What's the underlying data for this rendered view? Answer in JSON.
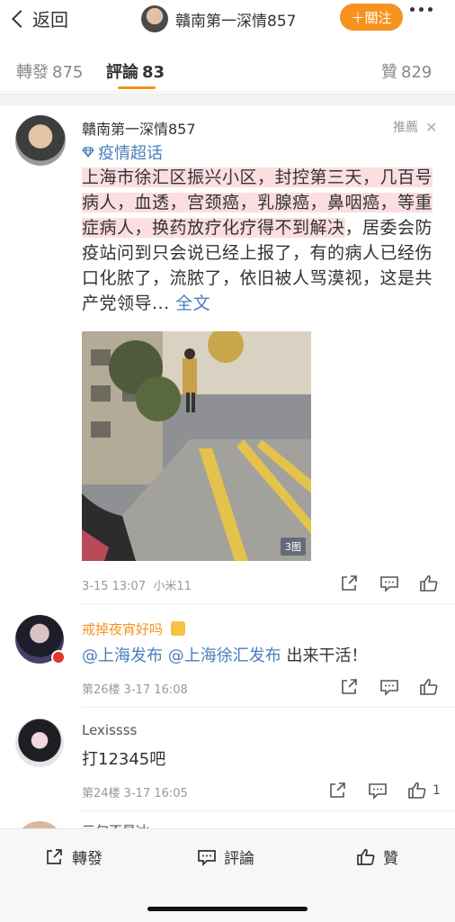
{
  "nav": {
    "back_label": "返回",
    "user_name": "贛南第一深情857",
    "follow_label": "＋關注"
  },
  "tabs": [
    {
      "label": "轉發",
      "count": "875"
    },
    {
      "label": "評論",
      "count": "83"
    },
    {
      "label": "贊",
      "count": "829"
    }
  ],
  "post": {
    "author": "贛南第一深情857",
    "recommend_label": "推薦",
    "close_glyph": "✕",
    "topic": "疫情超话",
    "text_highlight": "上海市徐汇区振兴小区，封控第三天，几百号病人，血透，宫颈癌，乳腺癌，鼻咽癌，等重症病人，换药放疗化疗得不到解决",
    "text_rest": "，居委会防疫站问到只会说已经上报了，有的病人已经伤口化脓了，流脓了，依旧被人骂漠视，这是共产党领导...",
    "full_text_label": "全文",
    "image_count": "3图",
    "time": "3-15 13:07",
    "device": "小米11"
  },
  "comments": [
    {
      "name": "戒掉夜宵好吗",
      "name_color": "#f6921e",
      "mention1": "@上海发布",
      "mention2": "@上海徐汇发布",
      "text": "出来干活！",
      "floor_time": "第26楼  3-17 16:08",
      "like_count": ""
    },
    {
      "name": "Lexissss",
      "name_color": "#555555",
      "text": "打12345吧",
      "floor_time": "第24楼  3-17 16:05",
      "like_count": "1"
    }
  ],
  "partial_next_name": "三句不是冰",
  "bottom_bar": {
    "repost": "轉發",
    "comment": "評論",
    "like": "贊"
  },
  "icons": {
    "back": "chevron-left-icon",
    "more": "more-dots-icon",
    "topic": "diamond-icon",
    "share": "share-icon",
    "comment": "comment-icon",
    "like": "thumb-up-icon"
  },
  "colors": {
    "accent": "#f6921e",
    "link": "#4a7fbb",
    "highlight": "#f5a0aa"
  }
}
